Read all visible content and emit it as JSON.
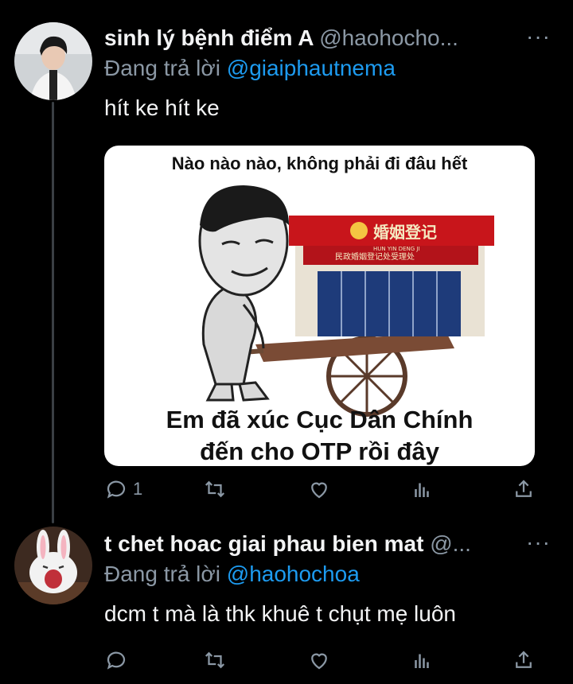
{
  "tweets": [
    {
      "name": "sinh lý bệnh điểm A",
      "handle": "@haohocho...",
      "replying_prefix": "Đang trả lời ",
      "replying_to": "@giaiphautnema",
      "text": "hít ke hít ke",
      "media": {
        "caption_top": "Nào nào nào, không phải đi đâu hết",
        "caption_bottom_line1": "Em đã xúc Cục Dân Chính",
        "caption_bottom_line2": "đến cho OTP rồi đây",
        "sign_text": "婚姻登记",
        "sign_subtext": "HUN YIN DENG JI",
        "banner_text": "民政婚姻登记处受理处"
      },
      "reply_count": "1",
      "more": "···"
    },
    {
      "name": "t chet hoac giai phau bien mat",
      "handle": "@...",
      "replying_prefix": "Đang trả lời ",
      "replying_to": "@haohochoa",
      "text": "dcm t mà là thk khuê t chụt mẹ luôn",
      "reply_count": "",
      "more": "···"
    }
  ]
}
